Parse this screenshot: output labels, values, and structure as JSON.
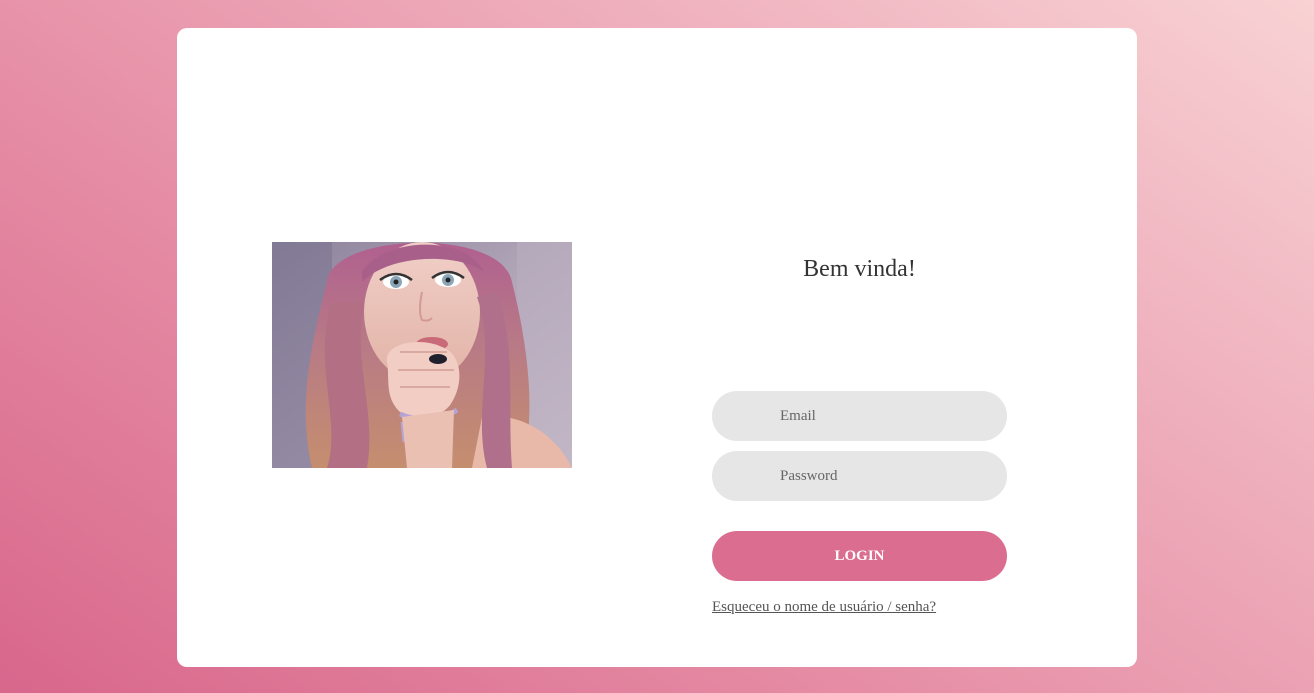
{
  "page": {
    "background_gradient": [
      "#d8678c",
      "#f8d2d4"
    ],
    "card_color": "#ffffff"
  },
  "login": {
    "title": "Bem vinda!",
    "email_placeholder": "Email",
    "password_placeholder": "Password",
    "button_label": "LOGIN",
    "button_color": "#db6e90",
    "forgot_link": "Esqueceu o nome de usuário / senha?"
  },
  "illustration": {
    "icon": "profile-photo"
  }
}
